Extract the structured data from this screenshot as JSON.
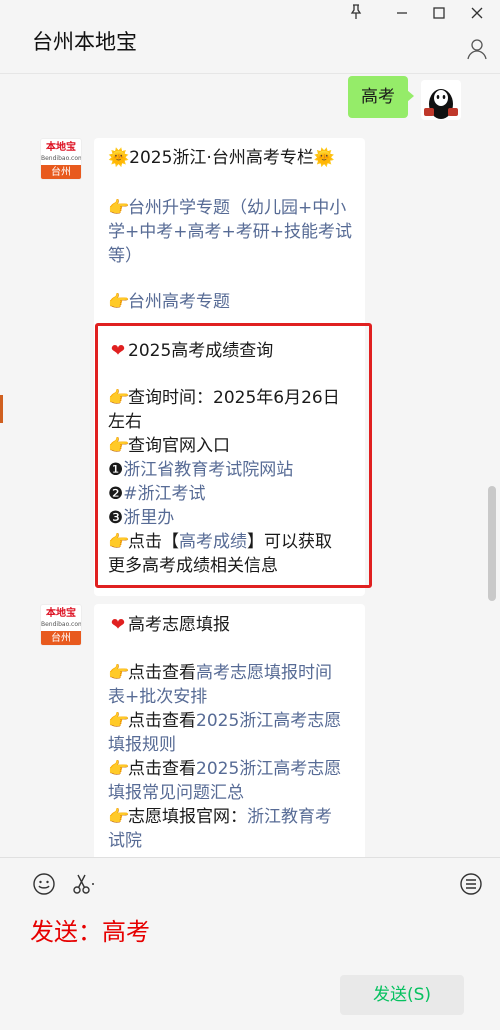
{
  "window": {
    "title": "台州本地宝"
  },
  "messages": {
    "me": {
      "text": "高考"
    },
    "account_avatar": {
      "brand": "本地宝",
      "sub": "Bendibao.com",
      "city": "台州"
    },
    "card1": {
      "lines": [
        "🌞2025浙江·台州高考专栏🌞",
        "台州升学专题（幼儿园+中小",
        "学+中考+高考+考研+技能考试",
        "等）",
        "台州高考专题"
      ]
    },
    "card1_box": {
      "lines": [
        "2025高考成绩查询",
        "查询时间：2025年6月26日",
        "左右",
        "查询官网入口",
        "浙江省教育考试院网站",
        "#浙江考试",
        "浙里办",
        "点击【",
        "高考成绩",
        "】可以获取",
        "更多高考成绩相关信息"
      ],
      "num1": "❶",
      "num2": "❷",
      "num3": "❸"
    },
    "card2": {
      "lines": [
        "高考志愿填报",
        "点击查看",
        "高考志愿填报时间",
        "表+批次安排",
        "点击查看",
        "2025浙江高考志愿",
        "填报规则",
        "点击查看",
        "2025浙江高考志愿",
        "填报常见问题汇总",
        "志愿填报官网：",
        "浙江教育考",
        "试院"
      ]
    }
  },
  "input": {
    "text": "发送：高考",
    "send_label": "发送(S)"
  },
  "icons": {
    "pin": "pin-icon",
    "minimize": "minimize-icon",
    "maximize": "maximize-icon",
    "close": "close-icon",
    "emoji": "emoji-icon",
    "scissors": "scissors-icon",
    "chat_history": "chat-history-icon",
    "profile": "profile-icon"
  },
  "colors": {
    "bubble_me": "#95ec69",
    "link": "#576b95",
    "highlight": "#e02020",
    "send_text": "#07c160"
  }
}
